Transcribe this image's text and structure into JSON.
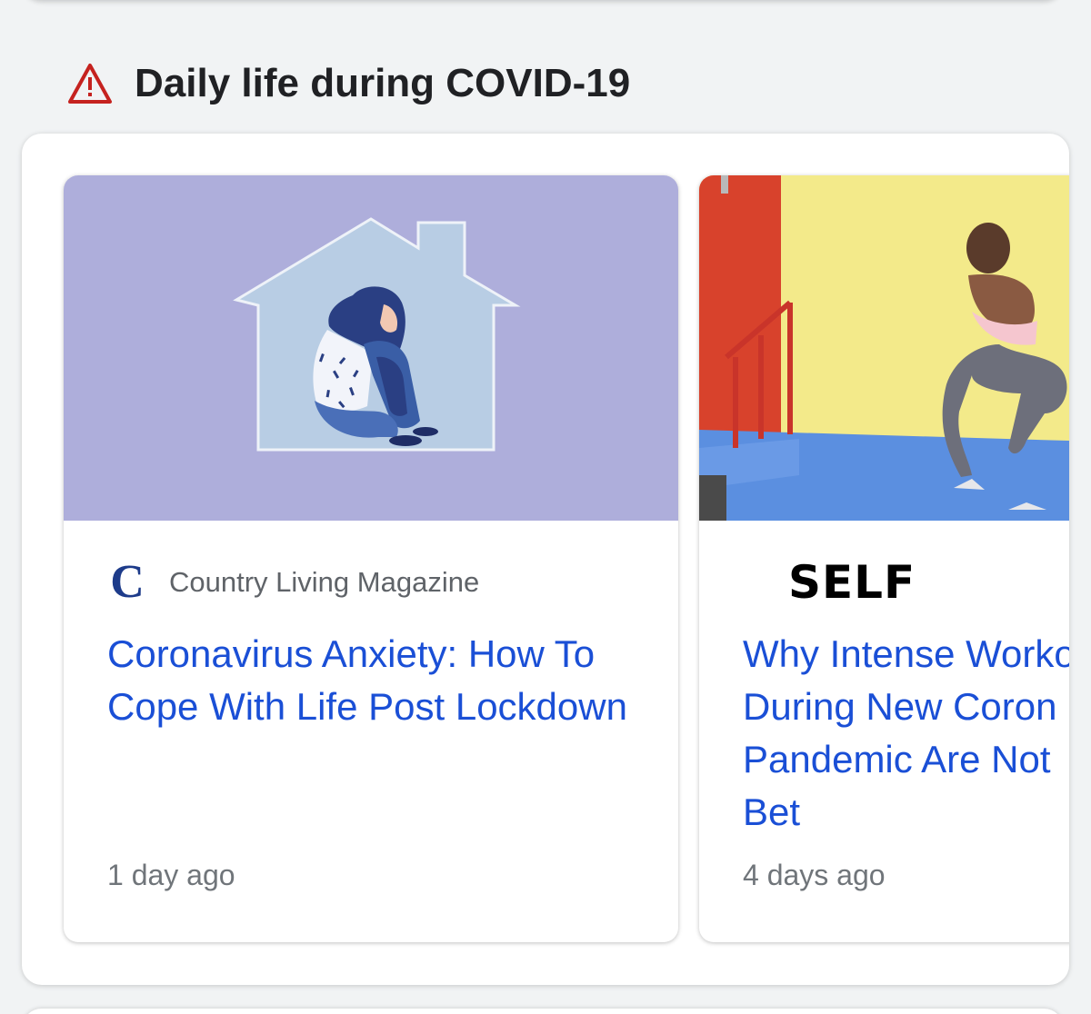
{
  "section": {
    "title": "Daily life during COVID-19",
    "icon": "warning-triangle-icon",
    "icon_color": "#c5221f"
  },
  "cards": [
    {
      "image": "woman-hugging-knees-in-house-illustration",
      "source_logo_text": "C",
      "source_name": "Country Living Magazine",
      "headline": "Coronavirus Anxiety: How To Cope With Life Post Lockdown",
      "timestamp": "1 day ago"
    },
    {
      "image": "woman-squatting-workout-photo",
      "source_logo_text": "SELF",
      "headline_lines": [
        "Why Intense Worko",
        "During New Coron",
        "Pandemic Are Not",
        "Bet"
      ],
      "timestamp": "4 days ago"
    }
  ],
  "colors": {
    "link": "#1a4fd6",
    "thumb1_bg": "#aeaedb",
    "house_fill": "#b8cde4"
  }
}
